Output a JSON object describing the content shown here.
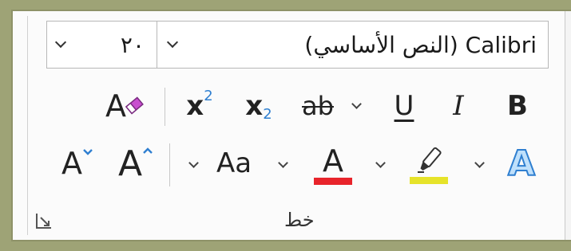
{
  "font_group": {
    "label": "خط",
    "font_size": {
      "value": "٢٠"
    },
    "font_name": {
      "value": "(النص الأساسي) Calibri"
    },
    "buttons": {
      "bold": "B",
      "italic": "I",
      "underline": "U",
      "strikethrough": "ab",
      "subscript_base": "x",
      "subscript_sub": "2",
      "superscript_base": "x",
      "superscript_sup": "2",
      "clear_format": "A",
      "grow_font": "A",
      "shrink_font": "A",
      "change_case": "Aa",
      "font_color": "A",
      "text_effects": "A"
    },
    "colors": {
      "font_color_bar": "#e8242b",
      "highlight_bar": "#e6e32a",
      "text_effect": "#3a8fd6",
      "accent_blue": "#2f7fd0",
      "eraser_pink": "#c84fcf"
    },
    "icons": {
      "size_dropdown": "chevron-down-icon",
      "font_dropdown": "chevron-down-icon",
      "clear_format": "clear-formatting-icon",
      "highlight": "highlighter-pen-icon",
      "launcher": "dialog-launcher-icon"
    }
  }
}
